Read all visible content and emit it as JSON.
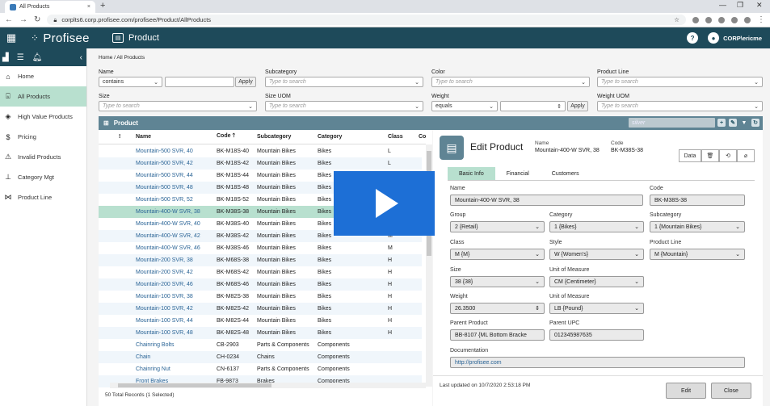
{
  "browser": {
    "tab_title": "All Products",
    "url": "corplts6.corp.profisee.com/profisee/Product/AllProducts"
  },
  "app": {
    "logo": "Profisee",
    "title": "Product",
    "user": "CORP\\ericme",
    "help": "?"
  },
  "sidebar": {
    "items": [
      {
        "label": "Home",
        "icon": "home-icon"
      },
      {
        "label": "All Products",
        "icon": "basket-icon"
      },
      {
        "label": "High Value Products",
        "icon": "tag-icon"
      },
      {
        "label": "Pricing",
        "icon": "dollar-icon"
      },
      {
        "label": "Invalid Products",
        "icon": "warning-icon"
      },
      {
        "label": "Category Mgt",
        "icon": "hierarchy-icon"
      },
      {
        "label": "Product Line",
        "icon": "network-icon"
      }
    ]
  },
  "breadcrumb": {
    "home": "Home",
    "sep": "/",
    "current": "All Products"
  },
  "filters": {
    "name_label": "Name",
    "name_op": "contains",
    "apply": "Apply",
    "subcategory_label": "Subcategory",
    "color_label": "Color",
    "productline_label": "Product Line",
    "size_label": "Size",
    "sizeuom_label": "Size UOM",
    "weight_label": "Weight",
    "weight_op": "equals",
    "weightuom_label": "Weight UOM",
    "placeholder": "Type to search"
  },
  "grid": {
    "title": "Product",
    "search_value": "silver",
    "headers": {
      "flag": "!",
      "name": "Name",
      "code": "Code",
      "sub": "Subcategory",
      "cat": "Category",
      "cls": "Class",
      "extra": "Co"
    },
    "rows": [
      {
        "name": "Mountain-500 SVR, 40",
        "code": "BK-M18S-40",
        "sub": "Mountain Bikes",
        "cat": "Bikes",
        "cls": "L"
      },
      {
        "name": "Mountain-500 SVR, 42",
        "code": "BK-M18S-42",
        "sub": "Mountain Bikes",
        "cat": "Bikes",
        "cls": "L"
      },
      {
        "name": "Mountain-500 SVR, 44",
        "code": "BK-M18S-44",
        "sub": "Mountain Bikes",
        "cat": "Bikes",
        "cls": ""
      },
      {
        "name": "Mountain-500 SVR, 48",
        "code": "BK-M18S-48",
        "sub": "Mountain Bikes",
        "cat": "Bikes",
        "cls": ""
      },
      {
        "name": "Mountain-500 SVR, 52",
        "code": "BK-M18S-52",
        "sub": "Mountain Bikes",
        "cat": "Bikes",
        "cls": ""
      },
      {
        "name": "Mountain-400-W SVR, 38",
        "code": "BK-M38S-38",
        "sub": "Mountain Bikes",
        "cat": "Bikes",
        "cls": ""
      },
      {
        "name": "Mountain-400-W SVR, 40",
        "code": "BK-M38S-40",
        "sub": "Mountain Bikes",
        "cat": "Bikes",
        "cls": ""
      },
      {
        "name": "Mountain-400-W SVR, 42",
        "code": "BK-M38S-42",
        "sub": "Mountain Bikes",
        "cat": "Bikes",
        "cls": "M"
      },
      {
        "name": "Mountain-400-W SVR, 46",
        "code": "BK-M38S-46",
        "sub": "Mountain Bikes",
        "cat": "Bikes",
        "cls": "M"
      },
      {
        "name": "Mountain-200 SVR, 38",
        "code": "BK-M68S-38",
        "sub": "Mountain Bikes",
        "cat": "Bikes",
        "cls": "H"
      },
      {
        "name": "Mountain-200 SVR, 42",
        "code": "BK-M68S-42",
        "sub": "Mountain Bikes",
        "cat": "Bikes",
        "cls": "H"
      },
      {
        "name": "Mountain-200 SVR, 46",
        "code": "BK-M68S-46",
        "sub": "Mountain Bikes",
        "cat": "Bikes",
        "cls": "H"
      },
      {
        "name": "Mountain-100 SVR, 38",
        "code": "BK-M82S-38",
        "sub": "Mountain Bikes",
        "cat": "Bikes",
        "cls": "H"
      },
      {
        "name": "Mountain-100 SVR, 42",
        "code": "BK-M82S-42",
        "sub": "Mountain Bikes",
        "cat": "Bikes",
        "cls": "H"
      },
      {
        "name": "Mountain-100 SVR, 44",
        "code": "BK-M82S-44",
        "sub": "Mountain Bikes",
        "cat": "Bikes",
        "cls": "H"
      },
      {
        "name": "Mountain-100 SVR, 48",
        "code": "BK-M82S-48",
        "sub": "Mountain Bikes",
        "cat": "Bikes",
        "cls": "H"
      },
      {
        "name": "Chainring Bolts",
        "code": "CB-2903",
        "sub": "Parts & Components",
        "cat": "Components",
        "cls": ""
      },
      {
        "name": "Chain",
        "code": "CH-0234",
        "sub": "Chains",
        "cat": "Components",
        "cls": ""
      },
      {
        "name": "Chainring Nut",
        "code": "CN-6137",
        "sub": "Parts & Components",
        "cat": "Components",
        "cls": ""
      },
      {
        "name": "Front Brakes",
        "code": "FB-9873",
        "sub": "Brakes",
        "cat": "Components",
        "cls": ""
      }
    ],
    "total": "50 Total Records (1 Selected)"
  },
  "edit": {
    "title": "Edit Product",
    "name_key": "Name",
    "name_val": "Mountain-400-W SVR, 38",
    "code_key": "Code",
    "code_val": "BK-M38S-38",
    "tab_data": "Data",
    "subtabs": [
      "Basic Info",
      "Financial",
      "Customers"
    ],
    "fields": {
      "name_label": "Name",
      "name": "Mountain-400-W SVR, 38",
      "code_label": "Code",
      "code": "BK-M38S-38",
      "group_label": "Group",
      "group": "2 {Retail}",
      "category_label": "Category",
      "category": "1 {Bikes}",
      "subcategory_label": "Subcategory",
      "subcategory": "1 {Mountain Bikes}",
      "class_label": "Class",
      "class": "M {M}",
      "style_label": "Style",
      "style": "W {Women's}",
      "productline_label": "Product Line",
      "productline": "M {Mountain}",
      "size_label": "Size",
      "size": "38 {38}",
      "uom_label": "Unit of Measure",
      "uom": "CM {Centimeter}",
      "weight_label": "Weight",
      "weight": "26.3500",
      "wuom_label": "Unit of Measure",
      "wuom": "LB {Pound}",
      "parent_label": "Parent Product",
      "parent": "BB-8107 {ML Bottom Bracke",
      "upc_label": "Parent UPC",
      "upc": "012345987635",
      "doc_label": "Documentation",
      "doc": "http://profisee.com"
    },
    "last_updated": "Last updated on 10/7/2020 2:53:18 PM",
    "edit_btn": "Edit",
    "close_btn": "Close"
  }
}
